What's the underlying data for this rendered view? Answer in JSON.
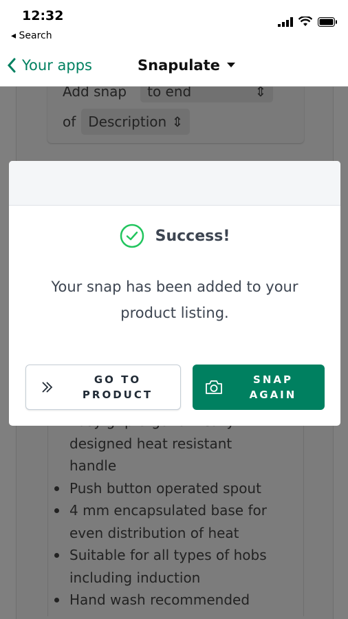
{
  "status_bar": {
    "time": "12:32",
    "back_label": "Search"
  },
  "nav": {
    "back_label": "Your apps",
    "title": "Snapulate"
  },
  "background": {
    "add_snap_label": "Add snap",
    "position_value": "to end",
    "of_label": "of",
    "field_value": "Description",
    "description_items": [
      {
        "text": "Easy grip ergonomically",
        "bullet": true
      },
      {
        "text": "designed heat resistant handle",
        "bullet": false
      },
      {
        "text": "Push button operated spout",
        "bullet": true
      },
      {
        "text": "4 mm encapsulated base for",
        "bullet": true
      },
      {
        "text": "even distribution of heat",
        "bullet": false
      },
      {
        "text": "Suitable for all types of hobs",
        "bullet": true
      },
      {
        "text": "including induction",
        "bullet": false
      },
      {
        "text": "Hand wash recommended",
        "bullet": true
      }
    ]
  },
  "modal": {
    "title": "Success!",
    "message": "Your snap has been added to your product listing.",
    "go_button": {
      "line1": "GO TO",
      "line2": "PRODUCT"
    },
    "snap_button": {
      "line1": "SNAP",
      "line2": "AGAIN"
    }
  },
  "colors": {
    "accent": "#008060",
    "success": "#22c55e"
  }
}
